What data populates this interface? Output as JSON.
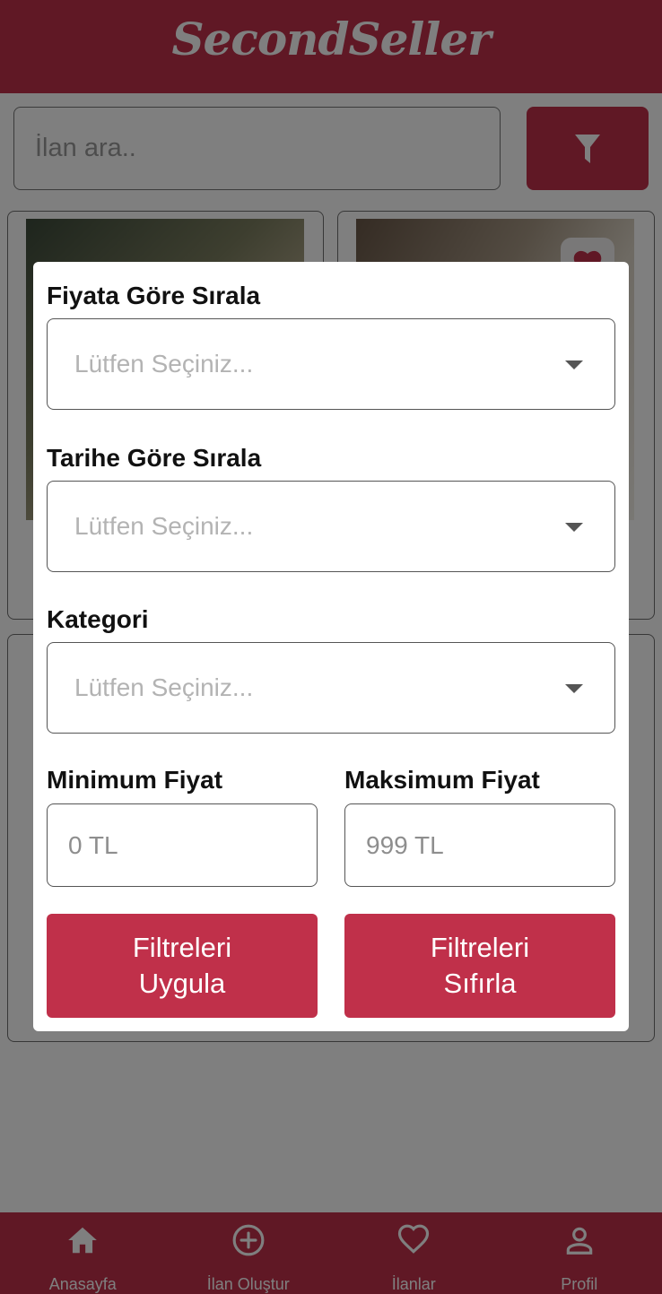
{
  "header": {
    "brand": "SecondSeller"
  },
  "search": {
    "placeholder": "İlan ara.."
  },
  "filter_modal": {
    "price_sort": {
      "label": "Fiyata Göre Sırala",
      "placeholder": "Lütfen Seçiniz..."
    },
    "date_sort": {
      "label": "Tarihe Göre Sırala",
      "placeholder": "Lütfen Seçiniz..."
    },
    "category": {
      "label": "Kategori",
      "placeholder": "Lütfen Seçiniz..."
    },
    "min_price": {
      "label": "Minimum Fiyat",
      "placeholder": "0 TL"
    },
    "max_price": {
      "label": "Maksimum Fiyat",
      "placeholder": "999 TL"
    },
    "apply_button": "Filtreleri Uygula",
    "reset_button": "Filtreleri Sıfırla"
  },
  "bottom_nav": {
    "items": [
      {
        "label": "Anasayfa",
        "icon": "home-icon"
      },
      {
        "label": "İlan Oluştur",
        "icon": "plus-circle-icon"
      },
      {
        "label": "İlanlar",
        "icon": "heart-icon"
      },
      {
        "label": "Profil",
        "icon": "user-icon"
      }
    ]
  },
  "colors": {
    "primary": "#c0304a",
    "overlay": "rgba(0,0,0,0.5)"
  }
}
